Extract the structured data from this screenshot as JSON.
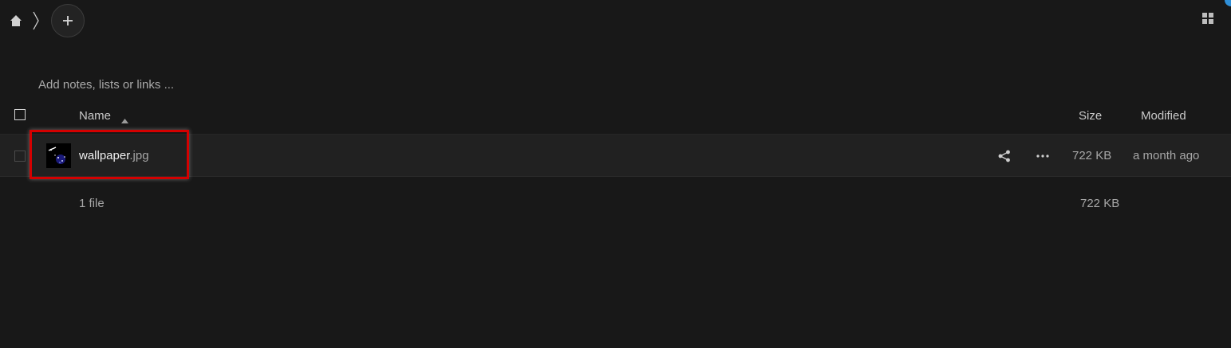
{
  "toolbar": {
    "home_icon": "home-icon",
    "separator_icon": "chevron-right-icon",
    "new_icon": "plus-icon",
    "view_icon": "grid-view-icon"
  },
  "notes": {
    "placeholder": "Add notes, lists or links ..."
  },
  "table": {
    "columns": {
      "name": "Name",
      "size": "Size",
      "modified": "Modified"
    },
    "sort": "ascending",
    "rows": [
      {
        "name": "wallpaper",
        "extension": ".jpg",
        "size": "722 KB",
        "modified": "a month ago",
        "selected": false,
        "highlighted": true
      }
    ],
    "summary": {
      "count": "1 file",
      "size": "722 KB"
    }
  },
  "colors": {
    "background": "#181818",
    "row_background": "#212121",
    "highlight": "#d40000",
    "accent": "#2f8fd8"
  }
}
